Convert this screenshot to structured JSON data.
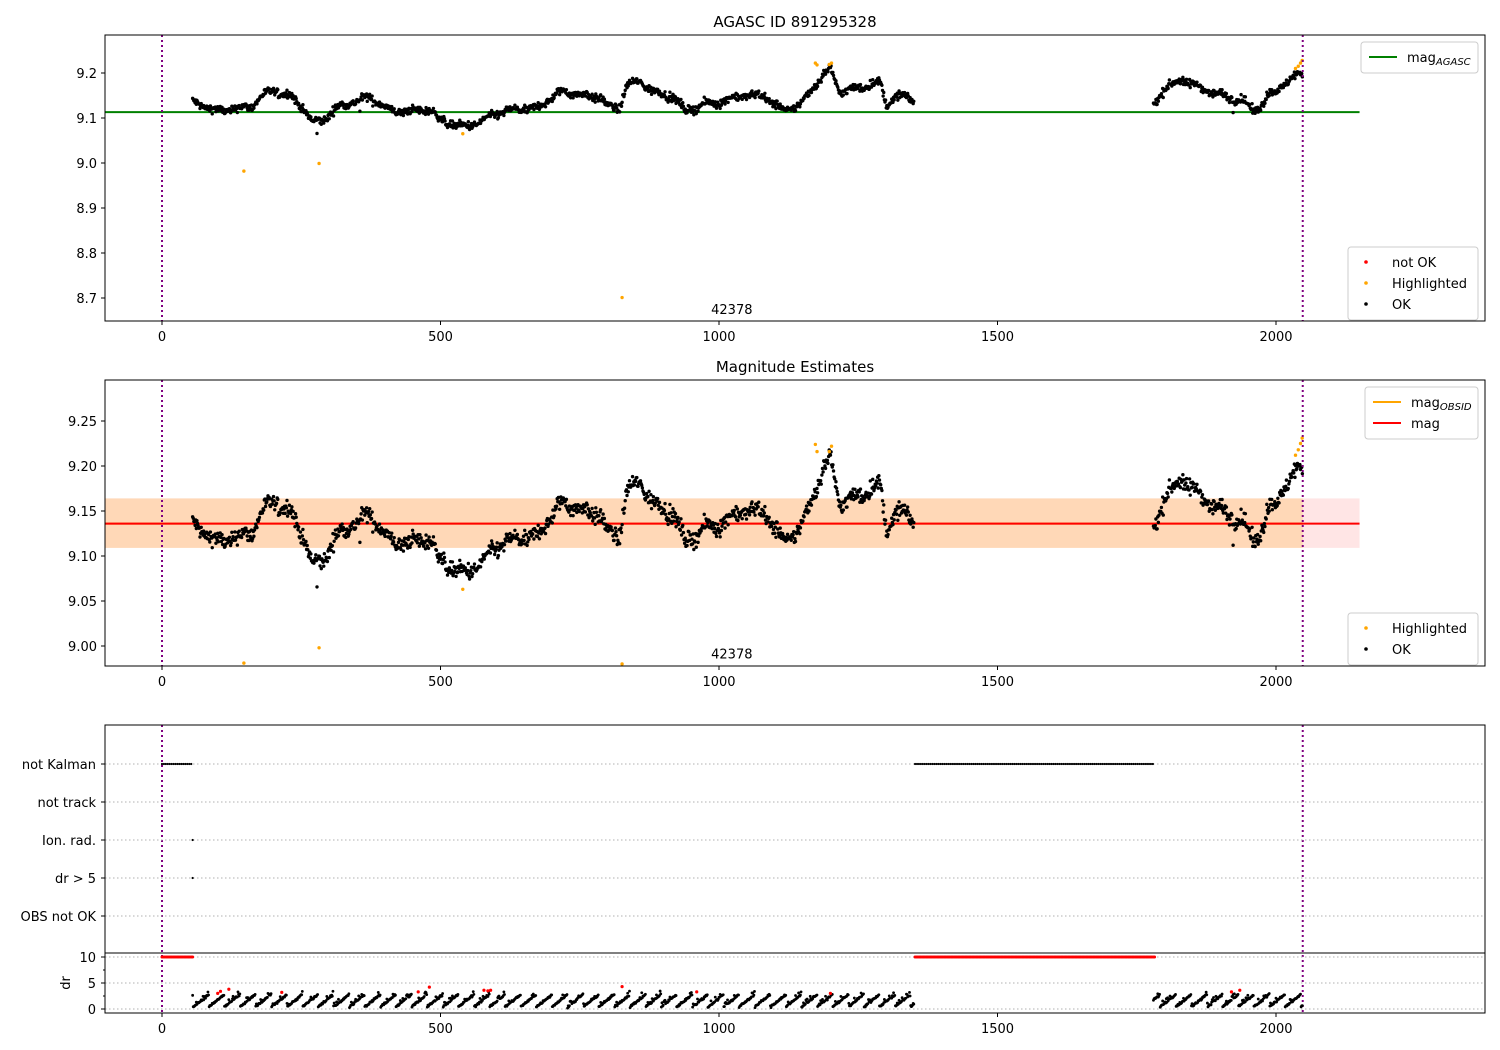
{
  "chart_data": [
    {
      "type": "scatter",
      "title": "AGASC ID 891295328",
      "xlim": [
        -102,
        2375
      ],
      "ylim": [
        8.649,
        9.284
      ],
      "xticks": [
        0,
        500,
        1000,
        1500,
        2000
      ],
      "yticks": [
        8.7,
        8.8,
        8.9,
        9.0,
        9.1,
        9.2
      ],
      "ytick_decimals": 1,
      "annotation": {
        "text": "42378",
        "x": 1023,
        "y": 8.665
      },
      "vlines": [
        0,
        2048
      ],
      "hline": {
        "name": "mag",
        "sub": "AGASC",
        "value": 9.113,
        "xmax": 2150,
        "color": "#008000"
      },
      "legend_top": [
        {
          "label": "mag",
          "sub": "AGASC",
          "color": "#008000",
          "kind": "line"
        }
      ],
      "legend_bottom": [
        {
          "label": "not OK",
          "color": "#ff0000",
          "kind": "dot"
        },
        {
          "label": "Highlighted",
          "color": "#ffa500",
          "kind": "dot"
        },
        {
          "label": "OK",
          "color": "#000000",
          "kind": "dot"
        }
      ],
      "highlighted": [
        [
          147,
          8.982
        ],
        [
          282,
          8.999
        ],
        [
          540,
          9.065
        ],
        [
          826,
          8.701
        ],
        [
          1173,
          9.222
        ],
        [
          1176,
          9.218
        ],
        [
          1198,
          9.219
        ],
        [
          1202,
          9.222
        ],
        [
          2035,
          9.21
        ],
        [
          2040,
          9.215
        ],
        [
          2044,
          9.222
        ],
        [
          2047,
          9.228
        ]
      ]
    },
    {
      "type": "scatter",
      "title": "Magnitude Estimates",
      "xlim": [
        -102,
        2375
      ],
      "ylim": [
        8.978,
        9.296
      ],
      "xticks": [
        0,
        500,
        1000,
        1500,
        2000
      ],
      "yticks": [
        9.0,
        9.05,
        9.1,
        9.15,
        9.2,
        9.25
      ],
      "ytick_decimals": 2,
      "annotation": {
        "text": "42378",
        "x": 1023,
        "y": 8.986
      },
      "vlines": [
        0,
        2048
      ],
      "mag": {
        "value": 9.136,
        "band": [
          9.109,
          9.164
        ],
        "xmax": 2150,
        "color": "#ff0000"
      },
      "mag_obsid": {
        "value": 9.136,
        "band": [
          9.109,
          9.164
        ],
        "xmax": 2048,
        "color": "#ffa500"
      },
      "legend_top": [
        {
          "label": "mag",
          "sub": "OBSID",
          "color": "#ffa500",
          "kind": "line"
        },
        {
          "label": "mag",
          "sub": "",
          "color": "#ff0000",
          "kind": "line"
        }
      ],
      "legend_bottom": [
        {
          "label": "Highlighted",
          "color": "#ffa500",
          "kind": "dot"
        },
        {
          "label": "OK",
          "color": "#000000",
          "kind": "dot"
        }
      ],
      "highlighted": [
        [
          147,
          8.981
        ],
        [
          282,
          8.998
        ],
        [
          540,
          9.063
        ],
        [
          826,
          8.98
        ],
        [
          1173,
          9.224
        ],
        [
          1176,
          9.216
        ],
        [
          1198,
          9.216
        ],
        [
          1202,
          9.222
        ],
        [
          2035,
          9.212
        ],
        [
          2040,
          9.218
        ],
        [
          2044,
          9.225
        ],
        [
          2047,
          9.231
        ]
      ]
    },
    {
      "type": "scatter",
      "title": "",
      "categories": [
        "not Kalman",
        "not track",
        "Ion. rad.",
        "dr > 5",
        "OBS not OK"
      ],
      "xticks": [
        0,
        500,
        1000,
        1500,
        2000
      ],
      "vlines": [
        0,
        2048
      ],
      "flag_ranges": {
        "not Kalman": [
          [
            0,
            55
          ],
          [
            1352,
            1782
          ]
        ],
        "Ion. rad.": [
          [
            55,
            55
          ]
        ],
        "dr > 5": [
          [
            55,
            55
          ]
        ]
      },
      "dr": {
        "ylabel": "dr",
        "yticks": [
          0,
          5,
          10
        ],
        "ylim": [
          -0.77,
          10.77
        ],
        "clipped_value": 10,
        "clipped_ranges": [
          [
            0,
            55
          ],
          [
            1352,
            1782
          ]
        ],
        "red_points": [
          [
            100,
            3.0
          ],
          [
            105,
            3.4
          ],
          [
            120,
            3.8
          ],
          [
            215,
            3.2
          ],
          [
            460,
            3.3
          ],
          [
            480,
            4.2
          ],
          [
            578,
            3.6
          ],
          [
            585,
            3.5
          ],
          [
            590,
            3.6
          ],
          [
            826,
            4.3
          ],
          [
            960,
            3.3
          ],
          [
            1200,
            3.0
          ],
          [
            1920,
            3.3
          ],
          [
            1935,
            3.6
          ]
        ]
      }
    }
  ],
  "trend": {
    "segments": [
      [
        [
          55,
          9.135
        ],
        [
          80,
          9.125
        ],
        [
          100,
          9.115
        ],
        [
          130,
          9.12
        ],
        [
          160,
          9.125
        ],
        [
          180,
          9.15
        ],
        [
          200,
          9.16
        ],
        [
          230,
          9.15
        ],
        [
          255,
          9.12
        ],
        [
          270,
          9.09
        ],
        [
          290,
          9.095
        ],
        [
          310,
          9.12
        ],
        [
          340,
          9.135
        ],
        [
          370,
          9.145
        ],
        [
          390,
          9.135
        ],
        [
          410,
          9.115
        ],
        [
          450,
          9.115
        ],
        [
          480,
          9.12
        ],
        [
          500,
          9.095
        ],
        [
          540,
          9.08
        ],
        [
          570,
          9.09
        ],
        [
          600,
          9.11
        ],
        [
          640,
          9.12
        ],
        [
          670,
          9.12
        ],
        [
          700,
          9.145
        ],
        [
          720,
          9.16
        ],
        [
          760,
          9.15
        ],
        [
          790,
          9.145
        ],
        [
          800,
          9.125
        ],
        [
          820,
          9.12
        ],
        [
          835,
          9.175
        ],
        [
          860,
          9.18
        ],
        [
          880,
          9.16
        ],
        [
          920,
          9.145
        ],
        [
          940,
          9.115
        ],
        [
          970,
          9.13
        ],
        [
          1000,
          9.135
        ],
        [
          1040,
          9.15
        ],
        [
          1080,
          9.15
        ],
        [
          1100,
          9.13
        ],
        [
          1120,
          9.115
        ],
        [
          1150,
          9.135
        ],
        [
          1170,
          9.17
        ],
        [
          1190,
          9.2
        ],
        [
          1200,
          9.21
        ],
        [
          1215,
          9.16
        ],
        [
          1250,
          9.165
        ],
        [
          1280,
          9.18
        ],
        [
          1290,
          9.175
        ],
        [
          1300,
          9.13
        ],
        [
          1320,
          9.15
        ],
        [
          1350,
          9.14
        ]
      ],
      [
        [
          1780,
          9.13
        ],
        [
          1800,
          9.165
        ],
        [
          1830,
          9.185
        ],
        [
          1860,
          9.17
        ],
        [
          1890,
          9.155
        ],
        [
          1920,
          9.145
        ],
        [
          1940,
          9.14
        ],
        [
          1960,
          9.115
        ],
        [
          1975,
          9.13
        ],
        [
          1985,
          9.15
        ],
        [
          2000,
          9.16
        ],
        [
          2030,
          9.19
        ],
        [
          2048,
          9.2
        ]
      ]
    ]
  }
}
